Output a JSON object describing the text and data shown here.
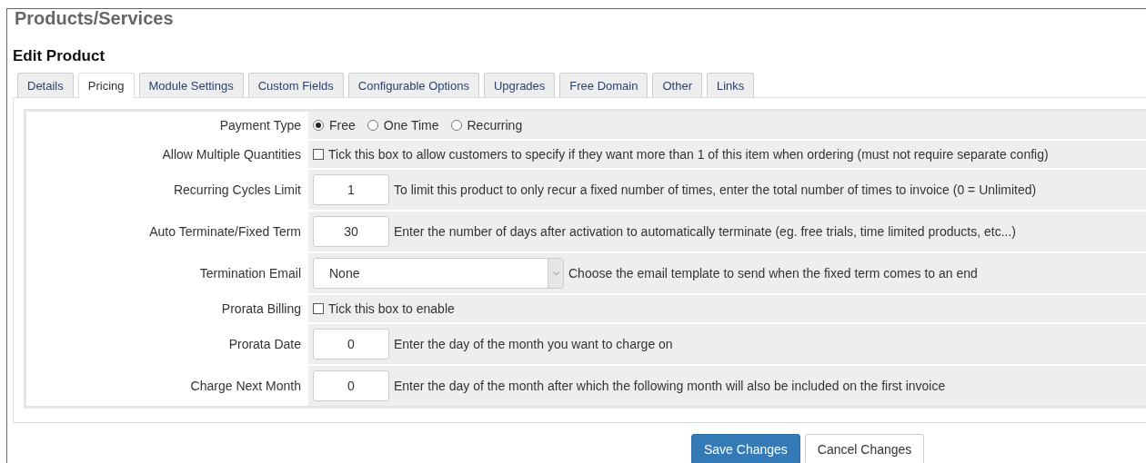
{
  "page_title": "Products/Services",
  "section_title": "Edit Product",
  "tabs": [
    {
      "label": "Details",
      "selected": false
    },
    {
      "label": "Pricing",
      "selected": true
    },
    {
      "label": "Module Settings",
      "selected": false
    },
    {
      "label": "Custom Fields",
      "selected": false
    },
    {
      "label": "Configurable Options",
      "selected": false
    },
    {
      "label": "Upgrades",
      "selected": false
    },
    {
      "label": "Free Domain",
      "selected": false
    },
    {
      "label": "Other",
      "selected": false
    },
    {
      "label": "Links",
      "selected": false
    }
  ],
  "rows": [
    {
      "kind": "radio",
      "label": "Payment Type",
      "options": [
        {
          "label": "Free",
          "selected": true
        },
        {
          "label": "One Time",
          "selected": false
        },
        {
          "label": "Recurring",
          "selected": false
        }
      ]
    },
    {
      "kind": "checkbox",
      "label": "Allow Multiple Quantities",
      "checked": false,
      "text": "Tick this box to allow customers to specify if they want more than 1 of this item when ordering (must not require separate config)"
    },
    {
      "kind": "number",
      "label": "Recurring Cycles Limit",
      "value": "1",
      "text": "To limit this product to only recur a fixed number of times, enter the total number of times to invoice (0 = Unlimited)"
    },
    {
      "kind": "number",
      "label": "Auto Terminate/Fixed Term",
      "value": "30",
      "text": "Enter the number of days after activation to automatically terminate (eg. free trials, time limited products, etc...)"
    },
    {
      "kind": "select",
      "label": "Termination Email",
      "value": "None",
      "text": "Choose the email template to send when the fixed term comes to an end"
    },
    {
      "kind": "checkbox",
      "label": "Prorata Billing",
      "checked": false,
      "text": "Tick this box to enable"
    },
    {
      "kind": "number",
      "label": "Prorata Date",
      "value": "0",
      "text": "Enter the day of the month you want to charge on"
    },
    {
      "kind": "number",
      "label": "Charge Next Month",
      "value": "0",
      "text": "Enter the day of the month after which the following month will also be included on the first invoice"
    }
  ],
  "buttons": [
    {
      "label": "Save Changes",
      "kind": "primary"
    },
    {
      "label": "Cancel Changes",
      "kind": "default"
    }
  ]
}
